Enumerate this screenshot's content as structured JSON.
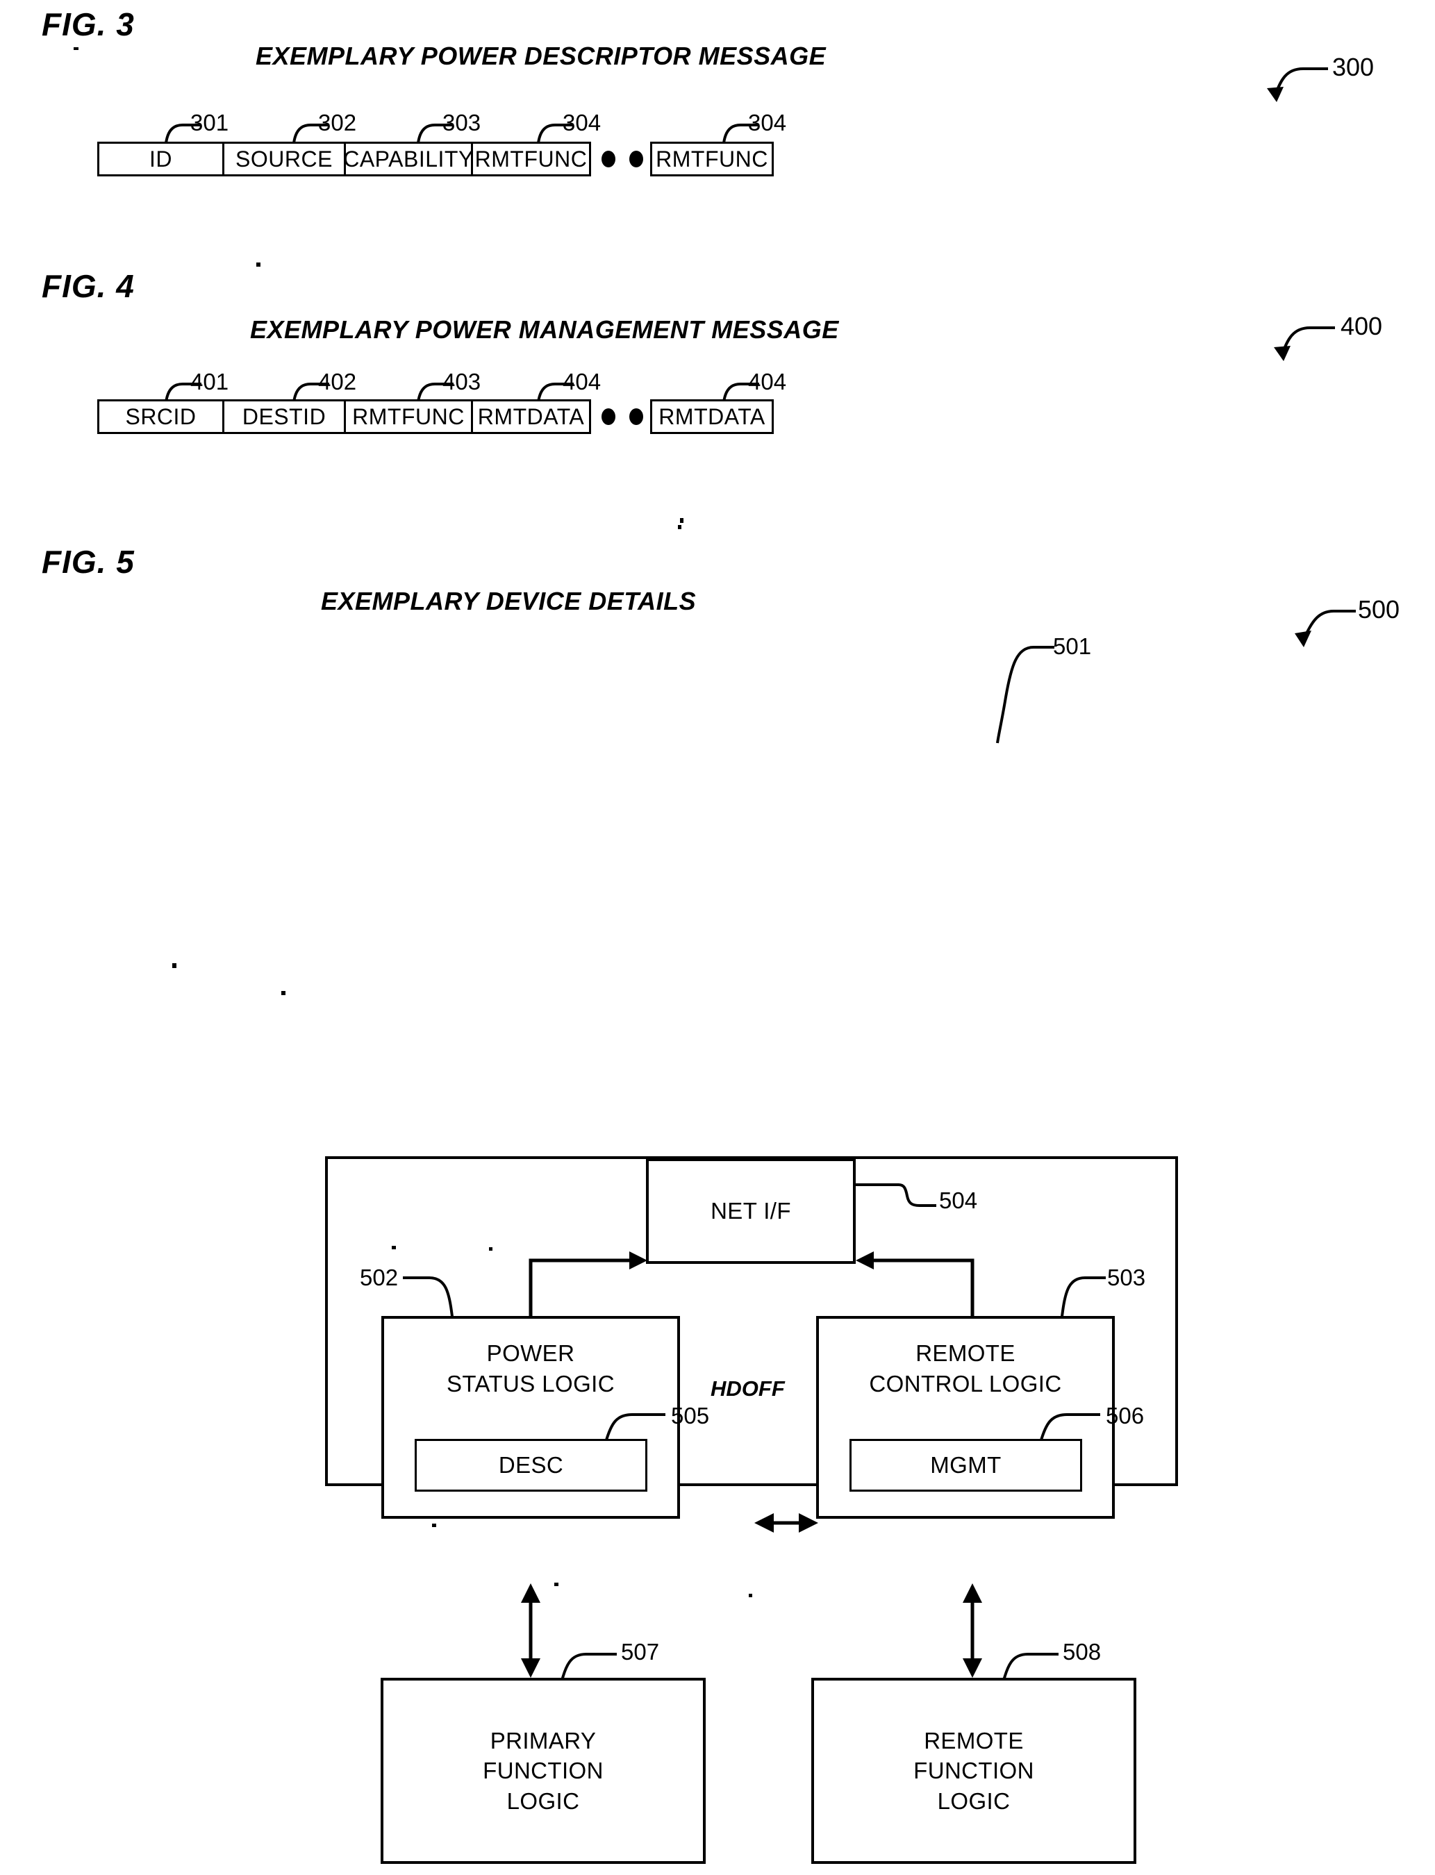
{
  "figures": [
    {
      "label": "FIG. 3",
      "title": "EXEMPLARY POWER DESCRIPTOR MESSAGE",
      "figure_ref": "300",
      "fields": [
        {
          "text": "ID",
          "ref": "301"
        },
        {
          "text": "SOURCE",
          "ref": "302"
        },
        {
          "text": "CAPABILITY",
          "ref": "303"
        },
        {
          "text": "RMTFUNC",
          "ref": "304"
        }
      ],
      "continuation": {
        "text": "RMTFUNC",
        "ref": "304"
      },
      "ellipsis_dots": 3
    },
    {
      "label": "FIG. 4",
      "title": "EXEMPLARY POWER MANAGEMENT MESSAGE",
      "figure_ref": "400",
      "fields": [
        {
          "text": "SRCID",
          "ref": "401"
        },
        {
          "text": "DESTID",
          "ref": "402"
        },
        {
          "text": "RMTFUNC",
          "ref": "403"
        },
        {
          "text": "RMTDATA",
          "ref": "404"
        }
      ],
      "continuation": {
        "text": "RMTDATA",
        "ref": "404"
      },
      "ellipsis_dots": 3
    }
  ],
  "fig5": {
    "label": "FIG. 5",
    "title": "EXEMPLARY DEVICE DETAILS",
    "figure_ref": "500",
    "device_ref": "501",
    "blocks": {
      "net_if": {
        "lines": [
          "NET I/F"
        ],
        "ref": "504"
      },
      "power_status": {
        "lines": [
          "POWER",
          "STATUS LOGIC"
        ],
        "ref": "502"
      },
      "remote_ctrl": {
        "lines": [
          "REMOTE",
          "CONTROL LOGIC"
        ],
        "ref": "503"
      },
      "desc": {
        "lines": [
          "DESC"
        ],
        "ref": "505"
      },
      "mgmt": {
        "lines": [
          "MGMT"
        ],
        "ref": "506"
      },
      "primary_fn": {
        "lines": [
          "PRIMARY",
          "FUNCTION",
          "LOGIC"
        ],
        "ref": "507"
      },
      "remote_fn": {
        "lines": [
          "REMOTE",
          "FUNCTION",
          "LOGIC"
        ],
        "ref": "508"
      }
    },
    "signal_label": "HDOFF"
  }
}
